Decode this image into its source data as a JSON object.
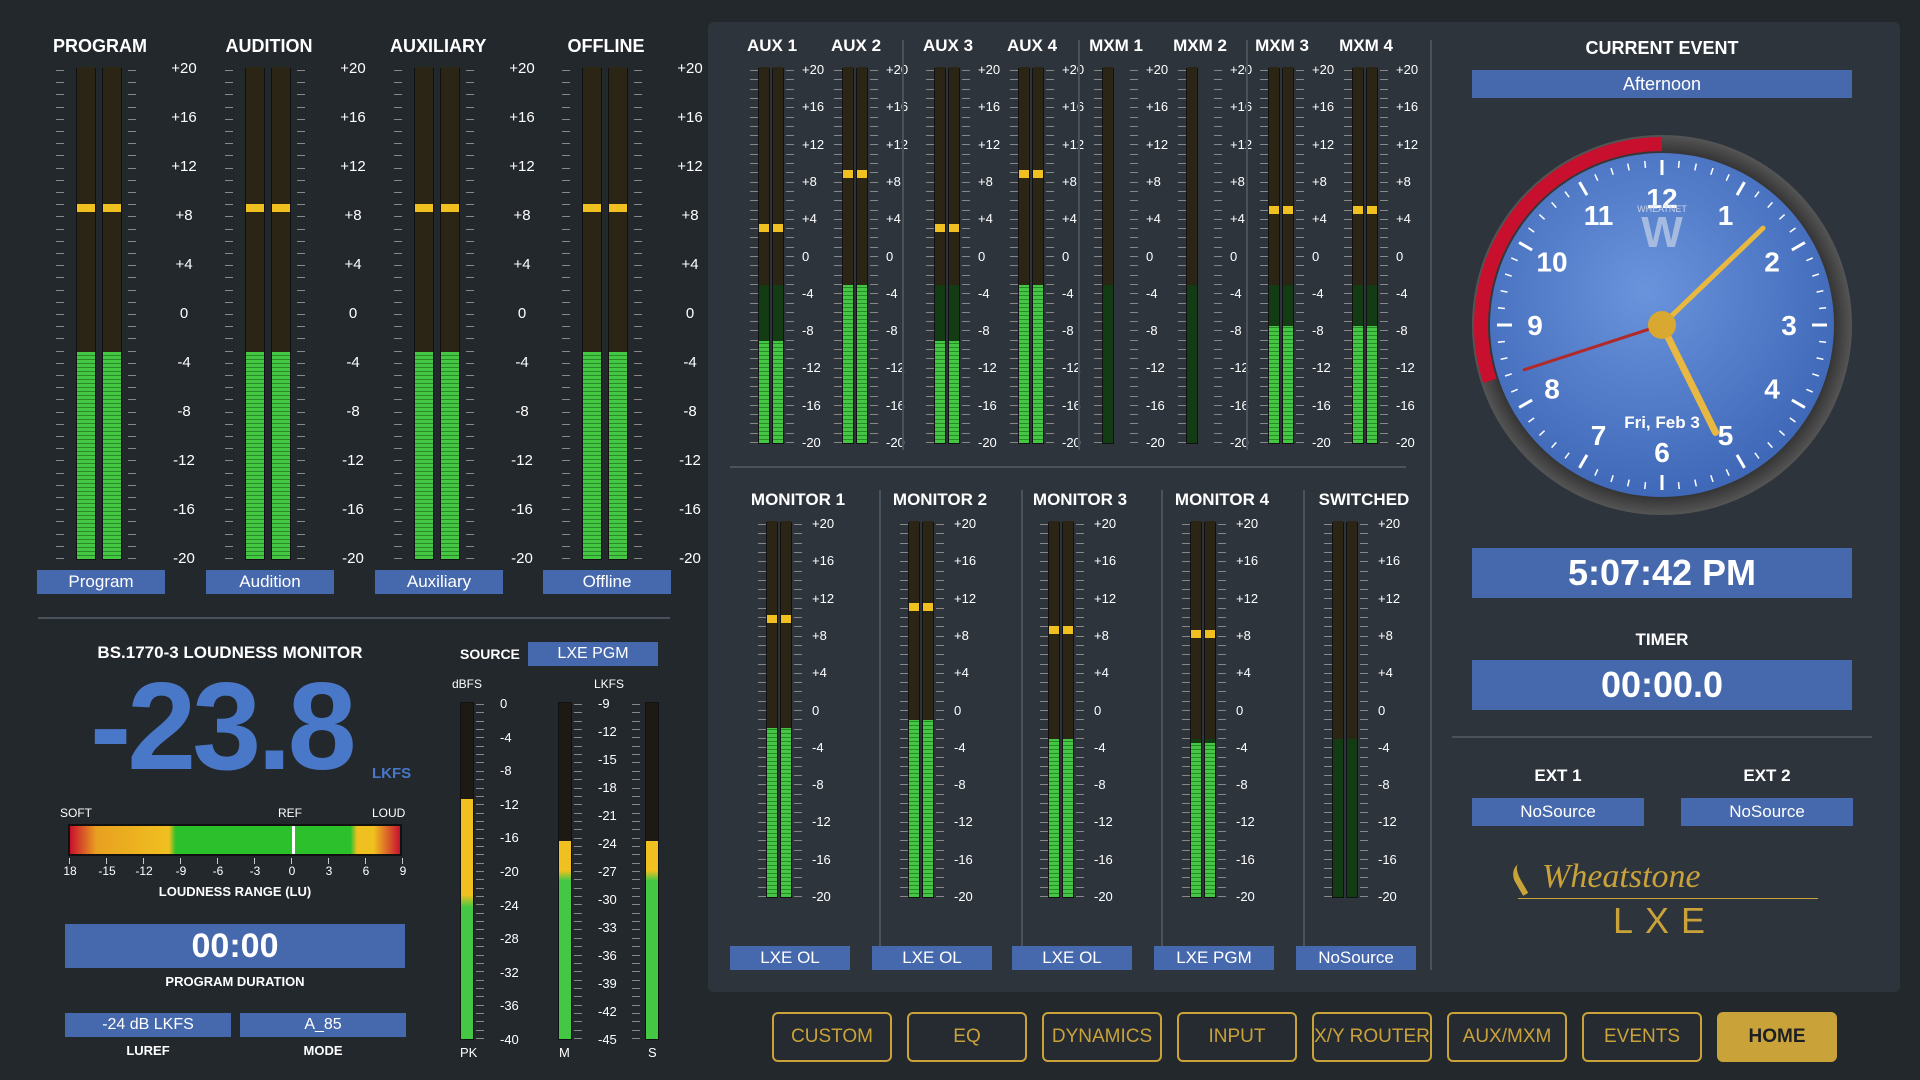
{
  "main_meters": [
    {
      "title": "PROGRAM",
      "label": "Program",
      "level": 0.42,
      "peak": 0.705
    },
    {
      "title": "AUDITION",
      "label": "Audition",
      "level": 0.42,
      "peak": 0.705
    },
    {
      "title": "AUXILIARY",
      "label": "Auxiliary",
      "level": 0.42,
      "peak": 0.705
    },
    {
      "title": "OFFLINE",
      "label": "Offline",
      "level": 0.42,
      "peak": 0.705
    }
  ],
  "main_scale": [
    "+20",
    "+16",
    "+12",
    "+8",
    "+4",
    "0",
    "-4",
    "-8",
    "-12",
    "-16",
    "-20"
  ],
  "aux_meters": [
    {
      "title": "AUX 1",
      "level": 0.27,
      "peak": 0.56
    },
    {
      "title": "AUX 2",
      "level": 0.42,
      "peak": 0.705
    },
    {
      "title": "AUX 3",
      "level": 0.27,
      "peak": 0.56
    },
    {
      "title": "AUX 4",
      "level": 0.42,
      "peak": 0.705
    },
    {
      "title": "MXM 1",
      "level": 0.0,
      "peak": 0.0
    },
    {
      "title": "MXM 2",
      "level": 0.0,
      "peak": 0.0
    },
    {
      "title": "MXM 3",
      "level": 0.31,
      "peak": 0.61
    },
    {
      "title": "MXM 4",
      "level": 0.31,
      "peak": 0.61
    }
  ],
  "small_scale": [
    "+20",
    "+16",
    "+12",
    "+8",
    "+4",
    "0",
    "-4",
    "-8",
    "-12",
    "-16",
    "-20"
  ],
  "monitor_meters": [
    {
      "title": "MONITOR 1",
      "label": "LXE OL",
      "level": 0.45,
      "peak": 0.73
    },
    {
      "title": "MONITOR 2",
      "label": "LXE OL",
      "level": 0.47,
      "peak": 0.76
    },
    {
      "title": "MONITOR 3",
      "label": "LXE OL",
      "level": 0.42,
      "peak": 0.7
    },
    {
      "title": "MONITOR 4",
      "label": "LXE PGM",
      "level": 0.41,
      "peak": 0.69
    },
    {
      "title": "SWITCHED",
      "label": "NoSource",
      "level": 0.0,
      "peak": 0.0
    }
  ],
  "loudness": {
    "title": "BS.1770-3 LOUDNESS MONITOR",
    "value": "-23.8",
    "unit": "LKFS",
    "soft": "SOFT",
    "ref": "REF",
    "loud": "LOUD",
    "range_ticks": [
      "18",
      "-15",
      "-12",
      "-9",
      "-6",
      "-3",
      "0",
      "3",
      "6",
      "9"
    ],
    "range_label": "LOUDNESS RANGE (LU)",
    "duration": "00:00",
    "duration_label": "PROGRAM DURATION",
    "luref": "-24 dB LKFS",
    "luref_label": "LUREF",
    "mode": "A_85",
    "mode_label": "MODE",
    "source_label": "SOURCE",
    "source": "LXE PGM",
    "dbfs_label": "dBFS",
    "lkfs_label": "LKFS",
    "dbfs_scale": [
      "0",
      "-4",
      "-8",
      "-12",
      "-16",
      "-20",
      "-24",
      "-28",
      "-32",
      "-36",
      "-40"
    ],
    "lkfs_scale": [
      "-9",
      "-12",
      "-15",
      "-18",
      "-21",
      "-24",
      "-27",
      "-30",
      "-33",
      "-36",
      "-39",
      "-42",
      "-45"
    ],
    "pk_label": "PK",
    "m_label": "M",
    "s_label": "S",
    "pk_level": 0.71,
    "m_level": 0.585,
    "s_level": 0.585
  },
  "clock": {
    "current_event_label": "CURRENT EVENT",
    "current_event": "Afternoon",
    "numbers": [
      "12",
      "1",
      "2",
      "3",
      "4",
      "5",
      "6",
      "7",
      "8",
      "9",
      "10",
      "11"
    ],
    "date": "Fri, Feb 3",
    "time": "5:07:42 PM",
    "timer_label": "TIMER",
    "timer": "00:00.0",
    "brand_small": "WHEATNET",
    "hour": 5,
    "minute": 7,
    "second": 42
  },
  "ext": [
    {
      "title": "EXT 1",
      "value": "NoSource"
    },
    {
      "title": "EXT 2",
      "value": "NoSource"
    }
  ],
  "brand": {
    "name": "Wheatstone",
    "model": "LXE"
  },
  "buttons": [
    {
      "label": "CUSTOM"
    },
    {
      "label": "EQ"
    },
    {
      "label": "DYNAMICS"
    },
    {
      "label": "INPUT"
    },
    {
      "label": "X/Y ROUTER"
    },
    {
      "label": "AUX/MXM"
    },
    {
      "label": "EVENTS"
    },
    {
      "label": "HOME"
    }
  ],
  "colors": {
    "accent": "#c9a23a",
    "label_bg": "#4668ad",
    "green": "#3cc23c",
    "yellow": "#f0c020",
    "red": "#c8102e",
    "clock_face": "#4a78c8"
  }
}
